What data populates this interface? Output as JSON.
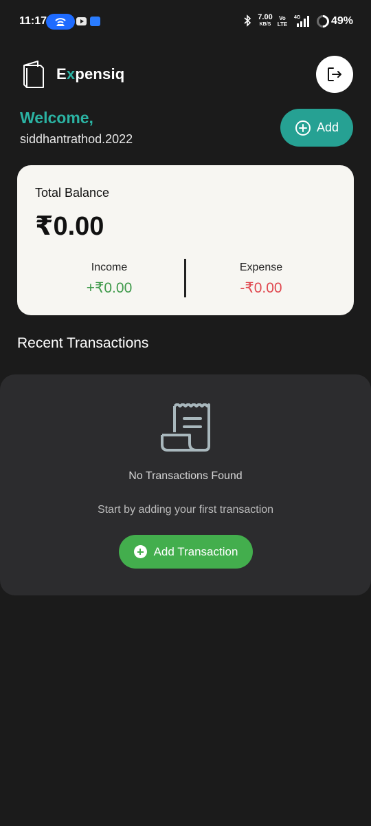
{
  "status_bar": {
    "time": "11:17",
    "net_speed_value": "7.00",
    "net_speed_unit": "KB/S",
    "volte_top": "Vo",
    "volte_bottom": "LTE",
    "network_type": "4G",
    "battery": "49%"
  },
  "header": {
    "brand_prefix": "E",
    "brand_accent": "x",
    "brand_suffix": "pensiq",
    "welcome": "Welcome,",
    "username": "siddhantrathod.2022",
    "add_label": "Add"
  },
  "balance": {
    "title": "Total Balance",
    "amount": "₹0.00",
    "income_label": "Income",
    "income_value": "+₹0.00",
    "expense_label": "Expense",
    "expense_value": "-₹0.00"
  },
  "transactions": {
    "section_title": "Recent Transactions",
    "empty_title": "No Transactions Found",
    "empty_subtitle": "Start by adding your first transaction",
    "add_button_label": "Add Transaction"
  },
  "colors": {
    "accent_teal": "#2bb3a3",
    "income_green": "#3f9a4b",
    "expense_red": "#e0484f",
    "add_tx_green": "#43ae4d"
  }
}
